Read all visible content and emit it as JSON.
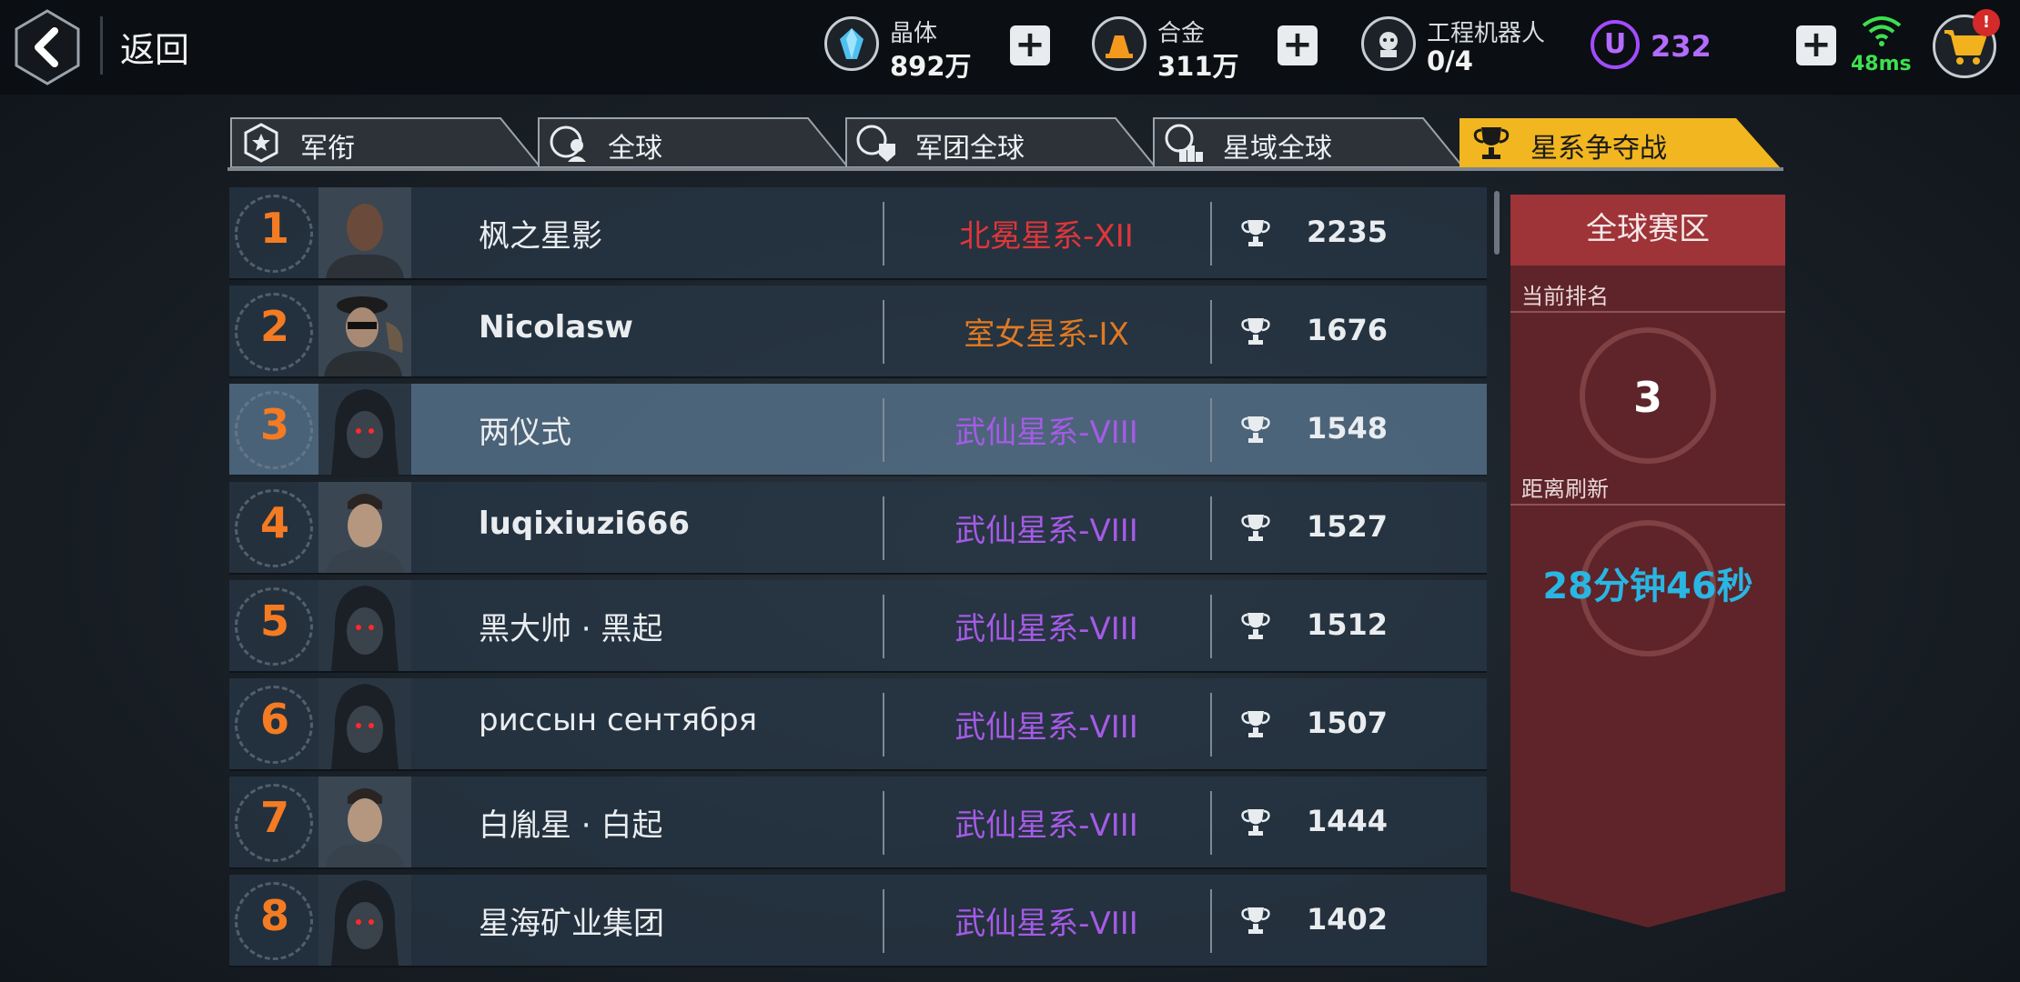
{
  "header": {
    "back_label": "返回",
    "resources": [
      {
        "name": "晶体",
        "value": "892万",
        "icon": "crystal-icon"
      },
      {
        "name": "合金",
        "value": "311万",
        "icon": "alloy-icon"
      },
      {
        "name": "工程机器人",
        "value": "0/4",
        "icon": "robot-icon"
      }
    ],
    "u_currency": {
      "icon_text": "U",
      "value": "232"
    },
    "network": {
      "ping": "48ms"
    },
    "cart": {
      "badge": "!"
    }
  },
  "tabs": [
    {
      "label": "军衔",
      "icon": "rank-badge-icon",
      "active": false
    },
    {
      "label": "全球",
      "icon": "globe-user-icon",
      "active": false
    },
    {
      "label": "军团全球",
      "icon": "legion-globe-icon",
      "active": false
    },
    {
      "label": "星域全球",
      "icon": "podium-globe-icon",
      "active": false
    },
    {
      "label": "星系争夺战",
      "icon": "trophy-icon",
      "active": true
    }
  ],
  "ranking": [
    {
      "rank": "1",
      "name": "枫之星影",
      "galaxy": "北冕星系-XII",
      "galaxy_color": "#e0363a",
      "score": "2235",
      "avatar": "bald-soldier-avatar",
      "bold": false,
      "highlight": false
    },
    {
      "rank": "2",
      "name": "Nicolasw",
      "galaxy": "室女星系-IX",
      "galaxy_color": "#e07a22",
      "score": "1676",
      "avatar": "beret-soldier-avatar",
      "bold": true,
      "highlight": false
    },
    {
      "rank": "3",
      "name": "两仪式",
      "galaxy": "武仙星系-VIII",
      "galaxy_color": "#a55be6",
      "score": "1548",
      "avatar": "hooded-figure-avatar",
      "bold": false,
      "highlight": true
    },
    {
      "rank": "4",
      "name": "luqixiuzi666",
      "galaxy": "武仙星系-VIII",
      "galaxy_color": "#a55be6",
      "score": "1527",
      "avatar": "soldier-avatar",
      "bold": true,
      "highlight": false
    },
    {
      "rank": "5",
      "name": "黑大帅 · 黑起",
      "galaxy": "武仙星系-VIII",
      "galaxy_color": "#a55be6",
      "score": "1512",
      "avatar": "hooded-figure-avatar",
      "bold": false,
      "highlight": false
    },
    {
      "rank": "6",
      "name": "риссын сентября",
      "galaxy": "武仙星系-VIII",
      "galaxy_color": "#a55be6",
      "score": "1507",
      "avatar": "hooded-figure-avatar",
      "bold": false,
      "highlight": false
    },
    {
      "rank": "7",
      "name": "白胤星 · 白起",
      "galaxy": "武仙星系-VIII",
      "galaxy_color": "#a55be6",
      "score": "1444",
      "avatar": "soldier-avatar",
      "bold": false,
      "highlight": false
    },
    {
      "rank": "8",
      "name": "星海矿业集团",
      "galaxy": "武仙星系-VIII",
      "galaxy_color": "#a55be6",
      "score": "1402",
      "avatar": "hooded-figure-avatar",
      "bold": false,
      "highlight": false
    }
  ],
  "panel": {
    "title": "全球赛区",
    "current_rank_label": "当前排名",
    "current_rank": "3",
    "refresh_label": "距离刷新",
    "refresh_time": "28分钟46秒"
  }
}
